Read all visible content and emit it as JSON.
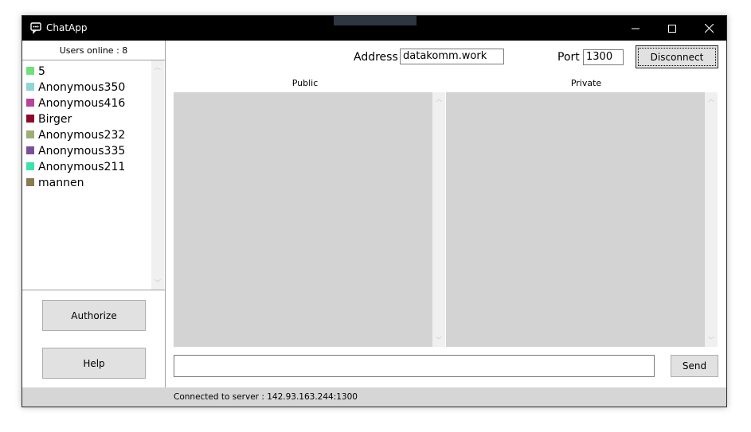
{
  "window": {
    "title": "ChatApp",
    "icon": "chat-app-icon",
    "controls": {
      "minimize": "—",
      "maximize": "☐",
      "close": "✕"
    }
  },
  "users": {
    "header": "Users online : 8",
    "items": [
      {
        "name": "5",
        "color": "#6fe07a"
      },
      {
        "name": "Anonymous350",
        "color": "#8ed6d3"
      },
      {
        "name": "Anonymous416",
        "color": "#b6449a"
      },
      {
        "name": "Birger",
        "color": "#8c0b2a"
      },
      {
        "name": "Anonymous232",
        "color": "#9caf74"
      },
      {
        "name": "Anonymous335",
        "color": "#7a4f9a"
      },
      {
        "name": "Anonymous211",
        "color": "#3ee2a7"
      },
      {
        "name": "mannen",
        "color": "#8b7a52"
      }
    ]
  },
  "buttons": {
    "authorize": "Authorize",
    "help": "Help",
    "disconnect": "Disconnect",
    "send": "Send"
  },
  "connection": {
    "address_label": "Address",
    "address_value": "datakomm.work",
    "port_label": "Port",
    "port_value": "1300"
  },
  "panes": {
    "public_label": "Public",
    "private_label": "Private"
  },
  "message_input": {
    "value": ""
  },
  "status": {
    "text": "Connected to server : 142.93.163.244:1300"
  },
  "colors": {
    "titlebar": "#000000",
    "pane_bg": "#d3d3d3",
    "statusbar": "#d6d6d6",
    "button": "#e1e1e1"
  }
}
